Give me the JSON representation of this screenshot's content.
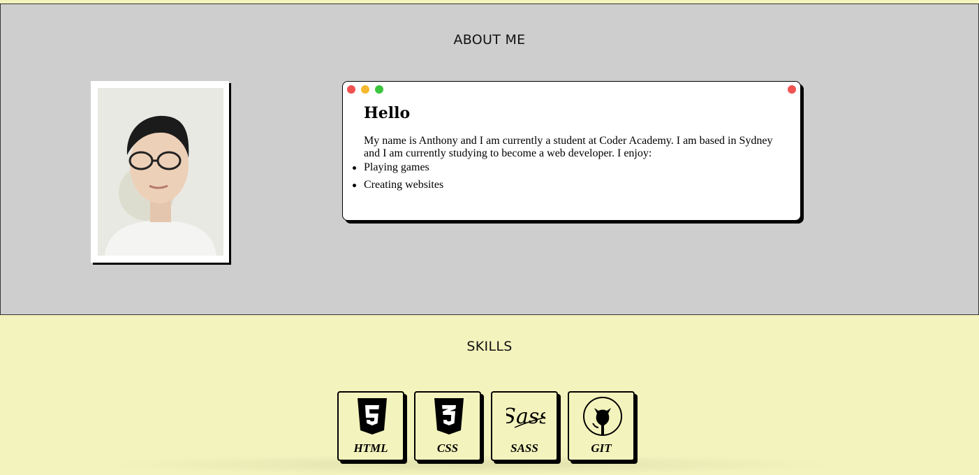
{
  "about": {
    "title": "ABOUT ME",
    "window": {
      "heading": "Hello",
      "bio": "My name is Anthony and I am currently a student at Coder Academy. I am based in Sydney and I am currently studying to become a web developer. I enjoy:",
      "likes": [
        "Playing games",
        "Creating websites"
      ],
      "dot_colors": [
        "#ef5350",
        "#f5b82e",
        "#3cc43c"
      ],
      "close_color": "#ef5350"
    },
    "photo_icon": "profile-photo"
  },
  "skills": {
    "title": "SKILLS",
    "items": [
      {
        "label": "HTML",
        "icon": "html5-icon"
      },
      {
        "label": "CSS",
        "icon": "css3-icon"
      },
      {
        "label": "SASS",
        "icon": "sass-icon"
      },
      {
        "label": "GIT",
        "icon": "github-icon"
      }
    ]
  },
  "colors": {
    "page_bg": "#f3f3bd",
    "about_bg": "#cecece",
    "card_border": "#000000"
  }
}
